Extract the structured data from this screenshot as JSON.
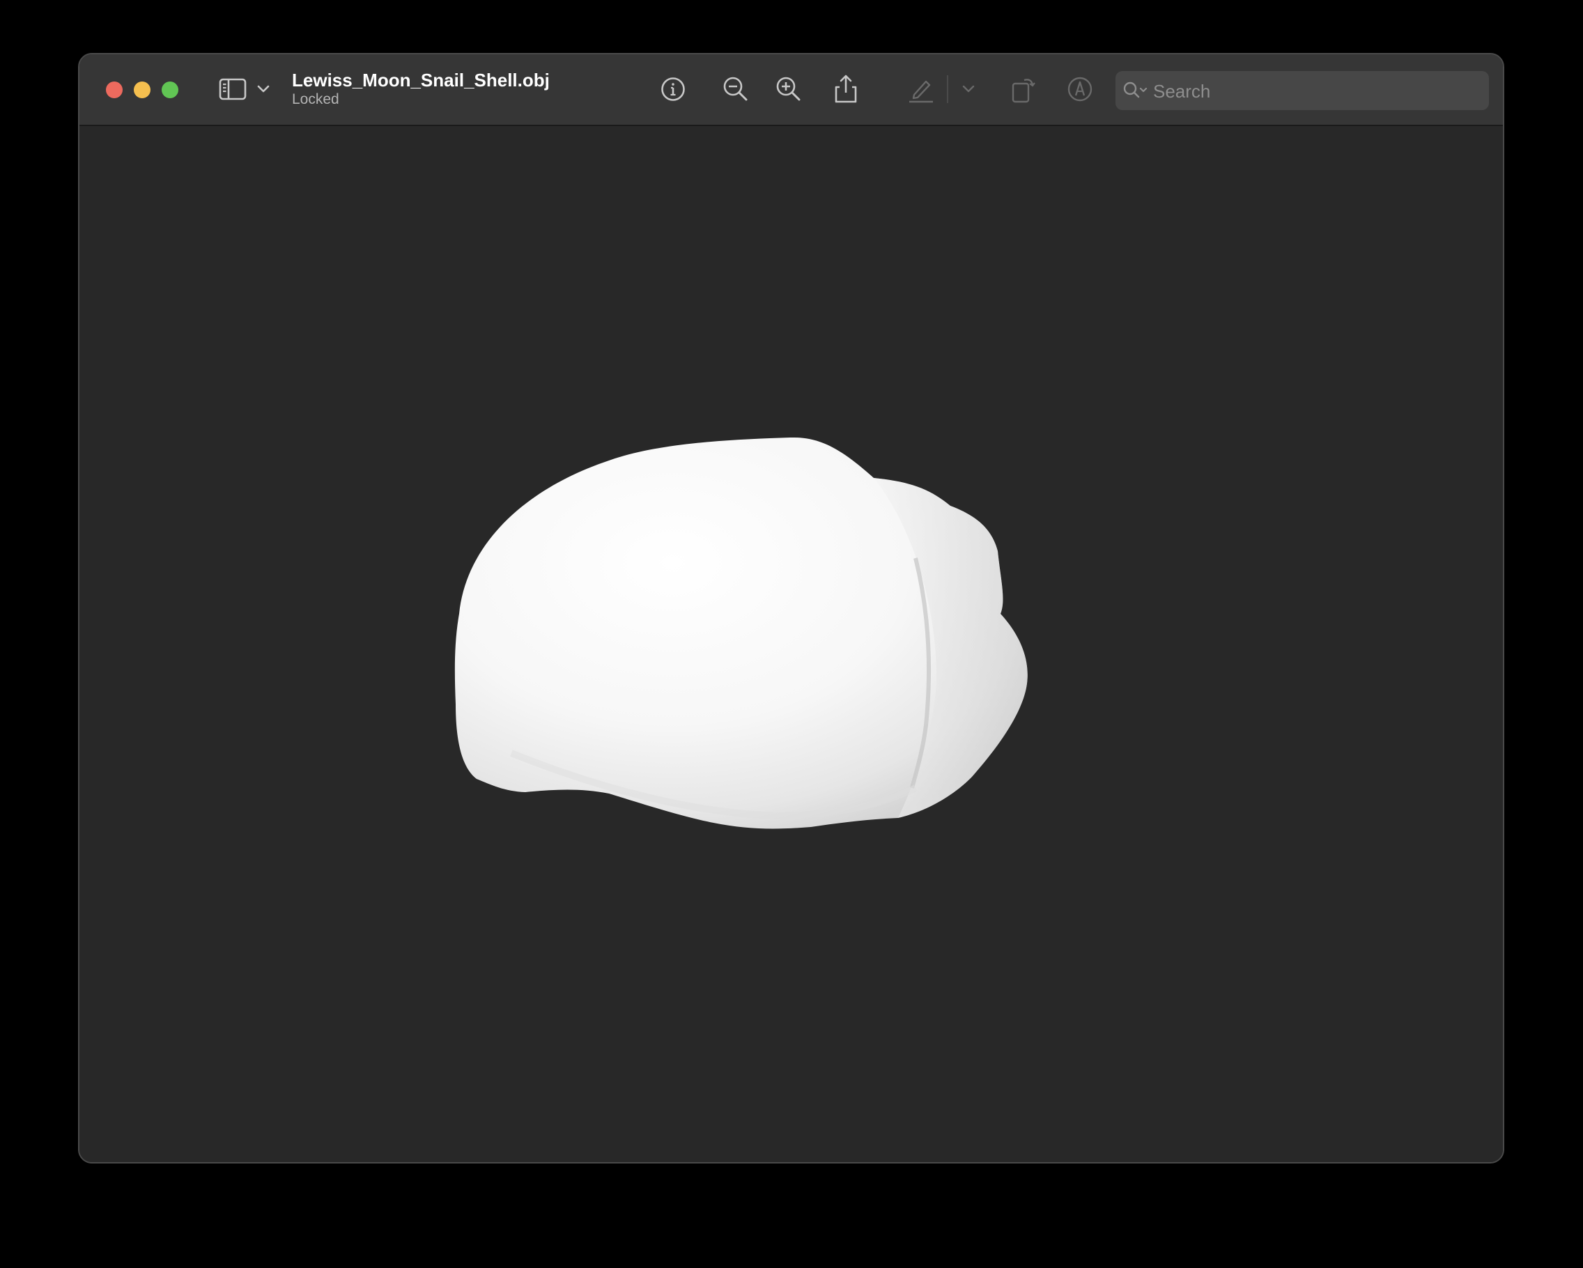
{
  "window": {
    "title": "Lewiss_Moon_Snail_Shell.obj",
    "subtitle": "Locked"
  },
  "toolbar": {
    "icons": {
      "sidebar": "sidebar-icon",
      "sidebar_menu": "chevron-down-icon",
      "info": "info-icon",
      "zoom_out": "zoom-out-icon",
      "zoom_in": "zoom-in-icon",
      "share": "share-icon",
      "markup": "pencil-icon",
      "markup_menu": "chevron-down-icon",
      "rotate": "rotate-icon",
      "annotate": "annotate-icon"
    }
  },
  "search": {
    "placeholder": "Search",
    "value": ""
  },
  "viewport": {
    "model": "moon-snail-shell-3d-model",
    "background": "#282828",
    "model_color": "#f2f2f2"
  }
}
